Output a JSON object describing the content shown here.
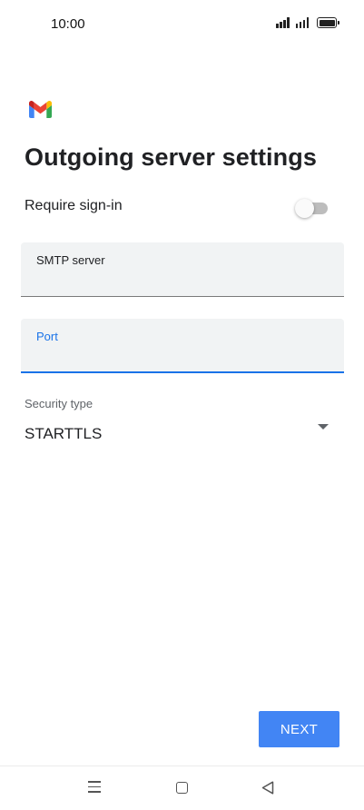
{
  "status_bar": {
    "time": "10:00"
  },
  "app": {
    "logo_icon": "gmail-icon",
    "brand_colors": [
      "#4285F4",
      "#EA4335",
      "#FBBC04",
      "#34A853",
      "#C5221F"
    ]
  },
  "page": {
    "title": "Outgoing server settings"
  },
  "require_signin": {
    "label": "Require sign-in",
    "enabled": false
  },
  "smtp_server": {
    "label": "SMTP server",
    "value": ""
  },
  "port": {
    "label": "Port",
    "value": "",
    "focused": true,
    "accent_color": "#1a73e8"
  },
  "security_type": {
    "label": "Security type",
    "selected": "STARTTLS"
  },
  "actions": {
    "next_label": "NEXT",
    "next_color": "#4285f4"
  },
  "navigation": {
    "menu_icon": "menu-icon",
    "home_icon": "home-square-icon",
    "back_icon": "back-triangle-icon"
  }
}
